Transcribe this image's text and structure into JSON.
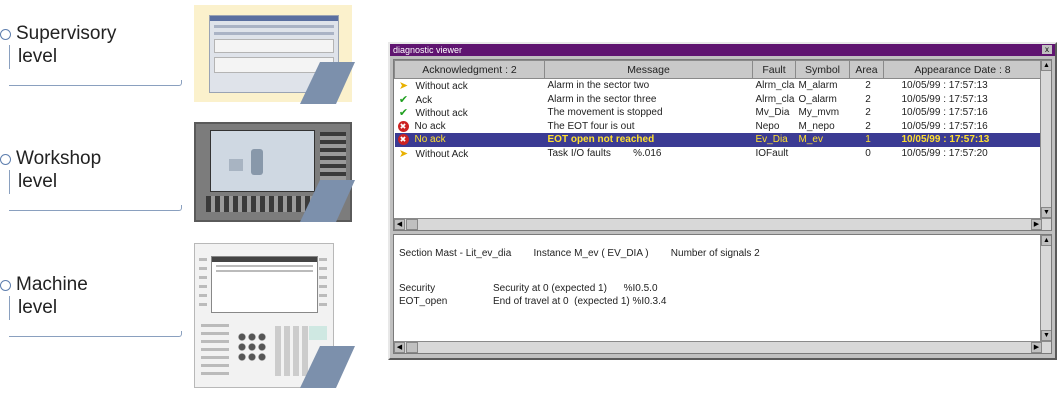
{
  "levels": [
    {
      "word": "Supervisory",
      "level": "level"
    },
    {
      "word": "Workshop",
      "level": "level"
    },
    {
      "word": "Machine",
      "level": "level"
    }
  ],
  "viewer": {
    "title": "diagnostic viewer",
    "close_label": "x",
    "columns": {
      "ack": "Acknowledgment : 2",
      "message": "Message",
      "fault": "Fault",
      "symbol": "Symbol",
      "area": "Area",
      "date": "Appearance Date : 8"
    },
    "rows": [
      {
        "icon": "arrow-icon",
        "ack": "Without ack",
        "message": "Alarm in the sector two",
        "fault": "Alrm_cla",
        "symbol": "M_alarm",
        "area": "2",
        "date": "10/05/99 : 17:57:13"
      },
      {
        "icon": "check-icon",
        "ack": "Ack",
        "message": "Alarm in the sector three",
        "fault": "Alrm_cla",
        "symbol": "O_alarm",
        "area": "2",
        "date": "10/05/99 : 17:57:13"
      },
      {
        "icon": "check-icon",
        "ack": "Without ack",
        "message": "The movement is stopped",
        "fault": "Mv_Dia",
        "symbol": "My_mvm",
        "area": "2",
        "date": "10/05/99 : 17:57:16"
      },
      {
        "icon": "error-icon",
        "ack": "No ack",
        "message": "The EOT four is out",
        "fault": "Nepo",
        "symbol": "M_nepo",
        "area": "2",
        "date": "10/05/99 : 17:57:16"
      },
      {
        "icon": "error-icon",
        "ack": "No ack",
        "message": "EOT open not reached",
        "fault": "Ev_Dia",
        "symbol": "M_ev",
        "area": "1",
        "date": "10/05/99 : 17:57:13"
      },
      {
        "icon": "arrow-icon",
        "ack": "Without Ack",
        "message": "Task I/O faults        %.016",
        "fault": "IOFault",
        "symbol": "",
        "area": "0",
        "date": "10/05/99 : 17:57:20"
      }
    ],
    "selected_row": 4,
    "detail": {
      "line1": "Section Mast - Lit_ev_dia        Instance M_ev ( EV_DIA )        Number of signals 2",
      "signals": [
        {
          "name": "Security",
          "desc": "Security at 0 (expected 1)      %I0.5.0"
        },
        {
          "name": "EOT_open",
          "desc": "End of travel at 0  (expected 1) %I0.3.4"
        }
      ]
    }
  }
}
